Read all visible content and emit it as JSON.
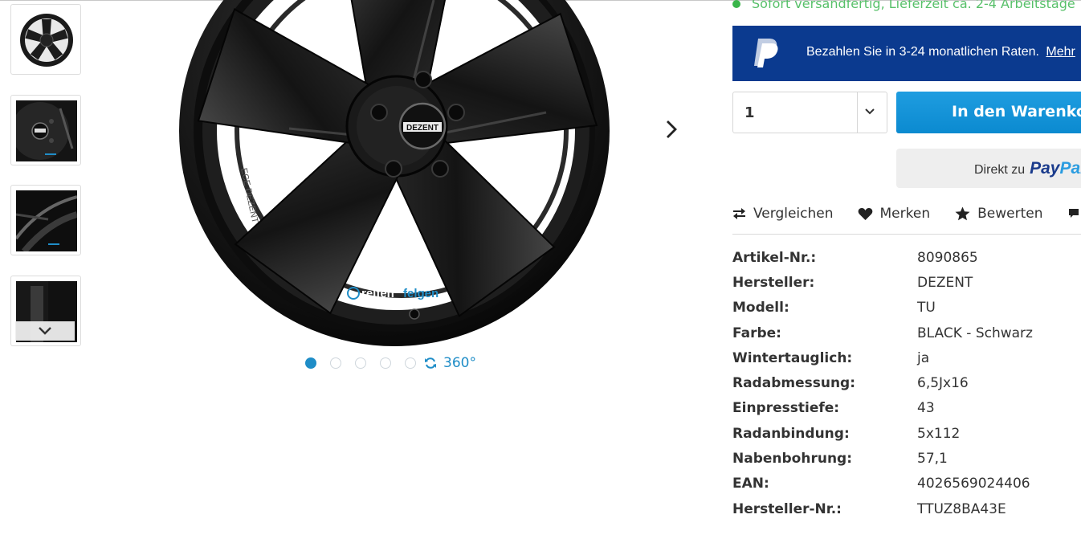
{
  "gallery": {
    "next_label": "next-image",
    "dots": [
      true,
      false,
      false,
      false,
      false
    ],
    "btn_360_label": "360°",
    "watermark_a": "reifen",
    "watermark_b": "felgen",
    "logo": "DEZENT",
    "rim_stamp": "ECE DEZENT"
  },
  "availability": {
    "text": "Sofort versandfertig, Lieferzeit ca. 2-4 Arbeitstage",
    "color": "#3ab54a"
  },
  "paypal_banner": {
    "text": "Bezahlen Sie in 3-24 monatlichen Raten.",
    "link": "Mehr"
  },
  "purchase": {
    "quantity": "1",
    "cart_button": "In den Warenkorb",
    "direct_label": "Direkt zu",
    "paypal_pay": "Pay",
    "paypal_pal": "Pal"
  },
  "actions": {
    "compare": "Vergleichen",
    "wishlist": "Merken",
    "rate": "Bewerten"
  },
  "properties": [
    {
      "key": "Artikel-Nr.:",
      "value": "8090865"
    },
    {
      "key": "Hersteller:",
      "value": "DEZENT"
    },
    {
      "key": "Modell:",
      "value": "TU"
    },
    {
      "key": "Farbe:",
      "value": "BLACK - Schwarz"
    },
    {
      "key": "Wintertauglich:",
      "value": "ja"
    },
    {
      "key": "Radabmessung:",
      "value": "6,5Jx16"
    },
    {
      "key": "Einpresstiefe:",
      "value": "43"
    },
    {
      "key": "Radanbindung:",
      "value": "5x112"
    },
    {
      "key": "Nabenbohrung:",
      "value": "57,1"
    },
    {
      "key": "EAN:",
      "value": "4026569024406"
    },
    {
      "key": "Hersteller-Nr.:",
      "value": "TTUZ8BA43E"
    }
  ],
  "colors": {
    "accent": "#1f8dc7",
    "paypal_bg": "#0b3a8f",
    "cart_bg": "#0b8ad0"
  }
}
